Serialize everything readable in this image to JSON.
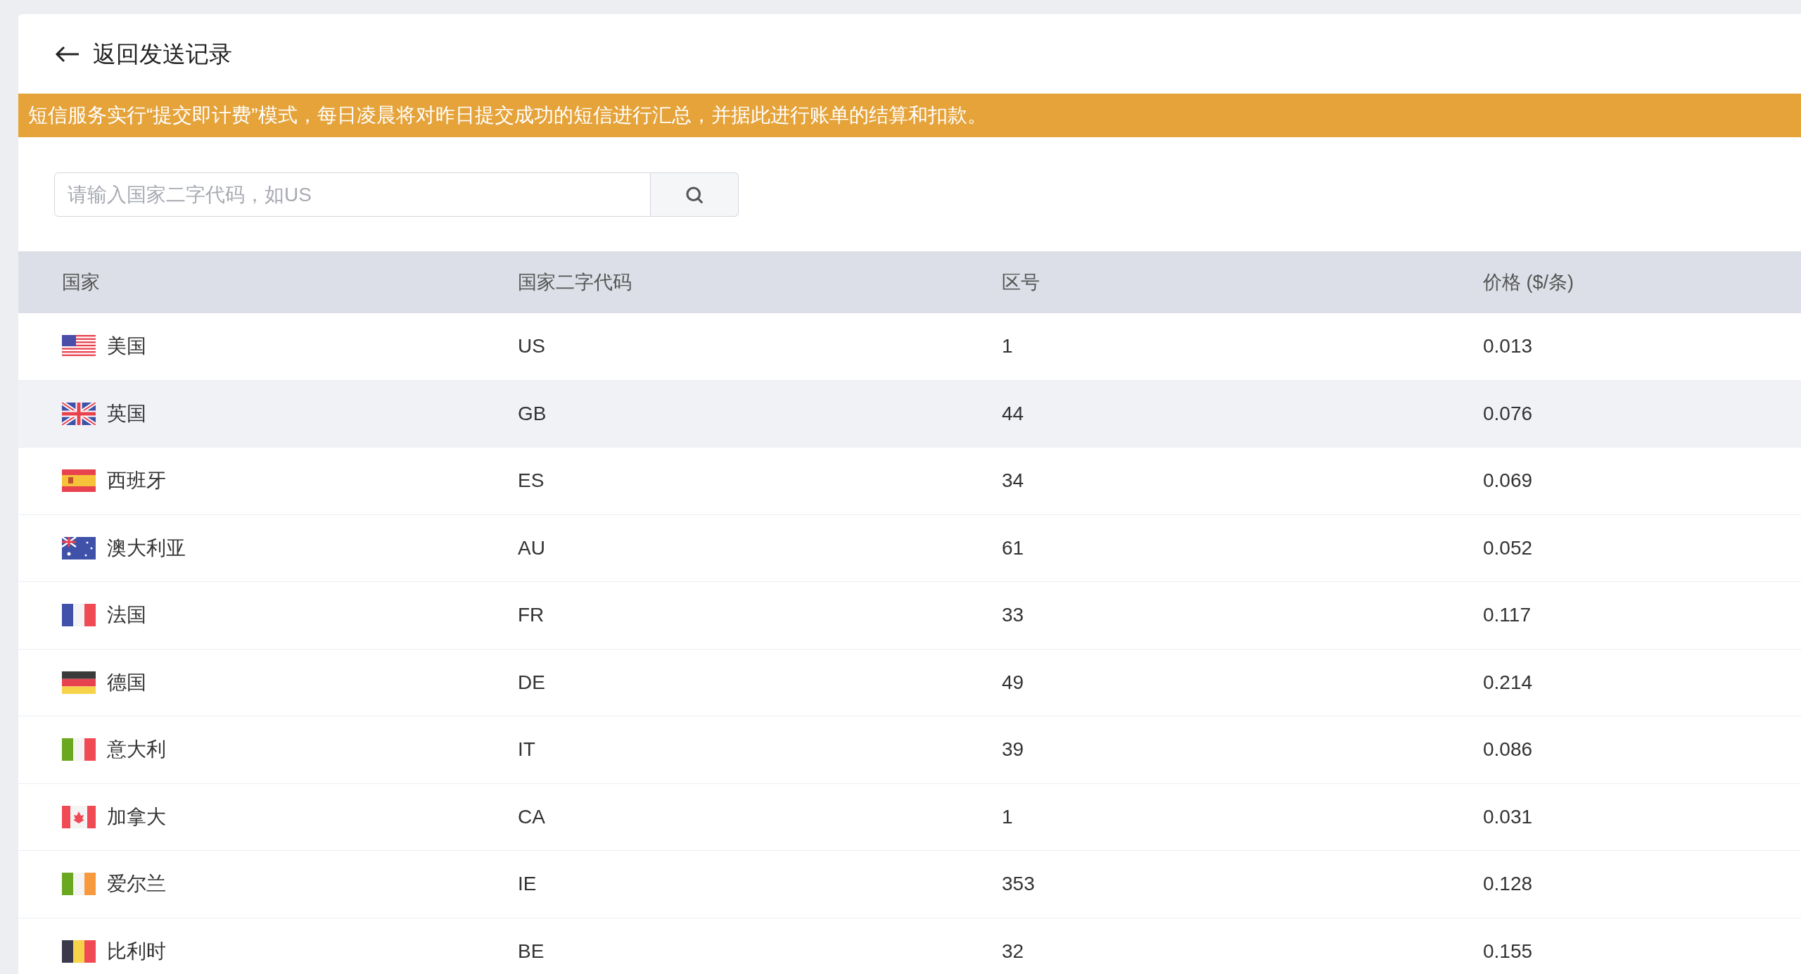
{
  "header": {
    "back_label": "返回发送记录"
  },
  "notice": "短信服务实行“提交即计费”模式，每日凌晨将对昨日提交成功的短信进行汇总，并据此进行账单的结算和扣款。",
  "search": {
    "placeholder": "请输入国家二字代码，如US"
  },
  "table": {
    "columns": [
      "国家",
      "国家二字代码",
      "区号",
      "价格 ($/条)"
    ],
    "rows": [
      {
        "kind": "us",
        "country": "美国",
        "code": "US",
        "dial": "1",
        "price": "0.013",
        "highlighted": false
      },
      {
        "kind": "gb",
        "country": "英国",
        "code": "GB",
        "dial": "44",
        "price": "0.076",
        "highlighted": true
      },
      {
        "kind": "es",
        "country": "西班牙",
        "code": "ES",
        "dial": "34",
        "price": "0.069",
        "highlighted": false
      },
      {
        "kind": "au",
        "country": "澳大利亚",
        "code": "AU",
        "dial": "61",
        "price": "0.052",
        "highlighted": false
      },
      {
        "kind": "fr",
        "country": "法国",
        "code": "FR",
        "dial": "33",
        "price": "0.117",
        "highlighted": false
      },
      {
        "kind": "de",
        "country": "德国",
        "code": "DE",
        "dial": "49",
        "price": "0.214",
        "highlighted": false
      },
      {
        "kind": "it",
        "country": "意大利",
        "code": "IT",
        "dial": "39",
        "price": "0.086",
        "highlighted": false
      },
      {
        "kind": "ca",
        "country": "加拿大",
        "code": "CA",
        "dial": "1",
        "price": "0.031",
        "highlighted": false
      },
      {
        "kind": "ie",
        "country": "爱尔兰",
        "code": "IE",
        "dial": "353",
        "price": "0.128",
        "highlighted": false
      },
      {
        "kind": "be",
        "country": "比利时",
        "code": "BE",
        "dial": "32",
        "price": "0.155",
        "highlighted": false
      }
    ]
  }
}
